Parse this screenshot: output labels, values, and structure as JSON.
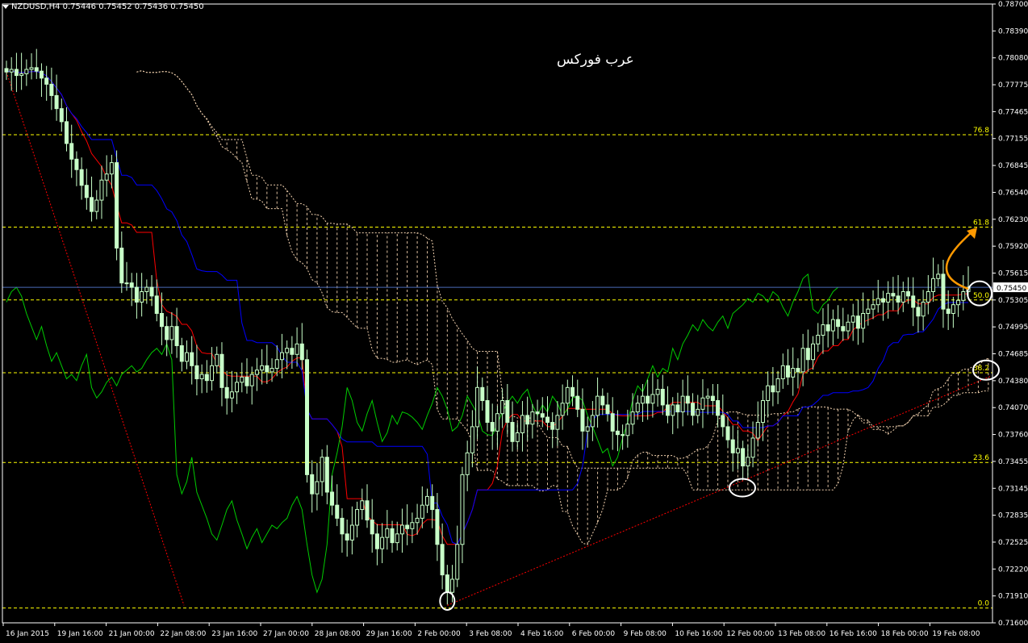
{
  "header": {
    "symbol": "NZDUSD,H4",
    "open": "0.75446",
    "high": "0.75452",
    "low": "0.75436",
    "close": "0.75450"
  },
  "watermark": "عرب فوركس",
  "colors": {
    "background": "#000000",
    "grid_frame": "#ffffff",
    "bull_candle": "#c8ffc8",
    "bear_candle": "#c8ffc8",
    "tenkan": "#ff0000",
    "kijun": "#0000ff",
    "chikou": "#00cc00",
    "cloud": "#f4d3b0",
    "fib_levels": "#ffff00",
    "trendline": "#ff0000",
    "arrow": "#ff9900",
    "current_price_line": "#4a6ab8",
    "circles": "#ffffff"
  },
  "chart_data": {
    "type": "candlestick",
    "instrument": "NZDUSD",
    "timeframe": "H4",
    "ylim": [
      0.716,
      0.787
    ],
    "y_ticks": [
      "0.78700",
      "0.78390",
      "0.78080",
      "0.77775",
      "0.77465",
      "0.77155",
      "0.76845",
      "0.76540",
      "0.76230",
      "0.75920",
      "0.75615",
      "0.75305",
      "0.74995",
      "0.74685",
      "0.74380",
      "0.74070",
      "0.73760",
      "0.73455",
      "0.73145",
      "0.72835",
      "0.72525",
      "0.72220",
      "0.71910",
      "0.71600"
    ],
    "x_ticks": [
      "16 Jan 2015",
      "19 Jan 16:00",
      "21 Jan 00:00",
      "22 Jan 08:00",
      "23 Jan 16:00",
      "27 Jan 00:00",
      "28 Jan 08:00",
      "29 Jan 16:00",
      "2 Feb 00:00",
      "3 Feb 08:00",
      "4 Feb 16:00",
      "6 Feb 00:00",
      "9 Feb 08:00",
      "10 Feb 16:00",
      "12 Feb 00:00",
      "13 Feb 08:00",
      "16 Feb 16:00",
      "18 Feb 00:00",
      "19 Feb 08:00"
    ],
    "current_price": "0.75450",
    "fibonacci": [
      {
        "label": "0.0",
        "price": 0.7177
      },
      {
        "label": "23.6",
        "price": 0.7344
      },
      {
        "label": "38.2",
        "price": 0.7447
      },
      {
        "label": "50.0",
        "price": 0.75305
      },
      {
        "label": "61.8",
        "price": 0.7614
      },
      {
        "label": "76.8",
        "price": 0.772
      }
    ],
    "close_series": [
      0.7792,
      0.7795,
      0.7788,
      0.779,
      0.7795,
      0.7797,
      0.7793,
      0.7785,
      0.7778,
      0.7765,
      0.775,
      0.7735,
      0.771,
      0.7692,
      0.768,
      0.7662,
      0.7648,
      0.7632,
      0.7645,
      0.7668,
      0.7675,
      0.7688,
      0.759,
      0.755,
      0.755,
      0.7545,
      0.7528,
      0.754,
      0.7545,
      0.7535,
      0.7515,
      0.75,
      0.7485,
      0.75,
      0.7478,
      0.746,
      0.747,
      0.7455,
      0.744,
      0.7445,
      0.7438,
      0.7455,
      0.7468,
      0.743,
      0.7418,
      0.7425,
      0.7436,
      0.7442,
      0.7432,
      0.7445,
      0.745,
      0.7455,
      0.7448,
      0.7452,
      0.7462,
      0.747,
      0.7475,
      0.7468,
      0.748,
      0.7462,
      0.733,
      0.7308,
      0.7322,
      0.735,
      0.731,
      0.7295,
      0.728,
      0.7262,
      0.7255,
      0.7272,
      0.729,
      0.73,
      0.7278,
      0.7262,
      0.7245,
      0.7258,
      0.7268,
      0.7252,
      0.7262,
      0.7272,
      0.7268,
      0.7275,
      0.728,
      0.7295,
      0.7305,
      0.729,
      0.725,
      0.7215,
      0.7195,
      0.721,
      0.725,
      0.733,
      0.7355,
      0.7385,
      0.743,
      0.7415,
      0.739,
      0.738,
      0.74,
      0.7415,
      0.739,
      0.7368,
      0.7378,
      0.7398,
      0.7388,
      0.7402,
      0.74,
      0.7396,
      0.739,
      0.7382,
      0.7398,
      0.7412,
      0.743,
      0.742,
      0.7405,
      0.738,
      0.7385,
      0.7398,
      0.742,
      0.741,
      0.74,
      0.738,
      0.7376,
      0.7375,
      0.7388,
      0.7402,
      0.7412,
      0.742,
      0.7412,
      0.7422,
      0.7428,
      0.741,
      0.7398,
      0.741,
      0.7402,
      0.742,
      0.7412,
      0.7398,
      0.7405,
      0.7418,
      0.742,
      0.7415,
      0.7398,
      0.7385,
      0.737,
      0.7355,
      0.736,
      0.734,
      0.735,
      0.7372,
      0.739,
      0.7415,
      0.7432,
      0.7425,
      0.744,
      0.7455,
      0.7442,
      0.7452,
      0.7448,
      0.7475,
      0.7462,
      0.748,
      0.749,
      0.7502,
      0.7495,
      0.7508,
      0.75,
      0.7495,
      0.7505,
      0.7512,
      0.7498,
      0.7515,
      0.752,
      0.7525,
      0.7532,
      0.7528,
      0.7538,
      0.7535,
      0.7528,
      0.754,
      0.7535,
      0.7522,
      0.7512,
      0.7528,
      0.754,
      0.7555,
      0.756,
      0.752,
      0.7515,
      0.7525,
      0.753,
      0.754,
      0.7545
    ]
  },
  "indicators": {
    "tenkan_kijun_chikou_cloud": "Ichimoku"
  }
}
